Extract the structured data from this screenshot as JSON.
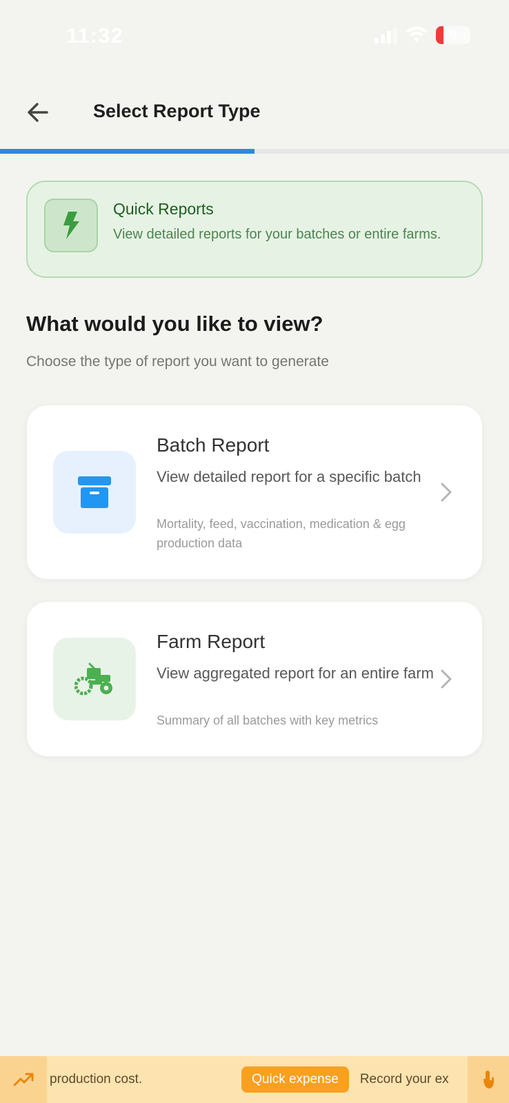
{
  "status_bar": {
    "time": "11:32",
    "battery_level": "9",
    "icons": [
      "signal-icon",
      "wifi-icon",
      "battery-icon"
    ]
  },
  "header": {
    "title": "Select Report Type",
    "back_icon": "arrow-left-icon"
  },
  "progress": {
    "fraction": 0.5,
    "color": "#2b8ae6"
  },
  "info_banner": {
    "title": "Quick Reports",
    "description": "View detailed reports for your batches or entire farms.",
    "icon": "lightning-bolt-icon",
    "accent": "#3a9d3f"
  },
  "main": {
    "heading": "What would you like to view?",
    "subheading": "Choose the type of report you want to generate"
  },
  "cards": [
    {
      "title": "Batch Report",
      "description": "View detailed report for a specific batch",
      "meta": "Mortality, feed, vaccination, medication & egg production data",
      "icon": "archive-box-icon",
      "icon_color": "#2196f3"
    },
    {
      "title": "Farm Report",
      "description": "View aggregated report for an entire farm",
      "meta": "Summary of all batches with key metrics",
      "icon": "tractor-icon",
      "icon_color": "#4caf50"
    }
  ],
  "ticker": {
    "left_icon": "trending-up-icon",
    "text_before": "production cost.",
    "chip_label": "Quick expense",
    "text_after": "Record your ex",
    "right_icon": "tap-hand-icon",
    "accent": "#f9a01f"
  }
}
